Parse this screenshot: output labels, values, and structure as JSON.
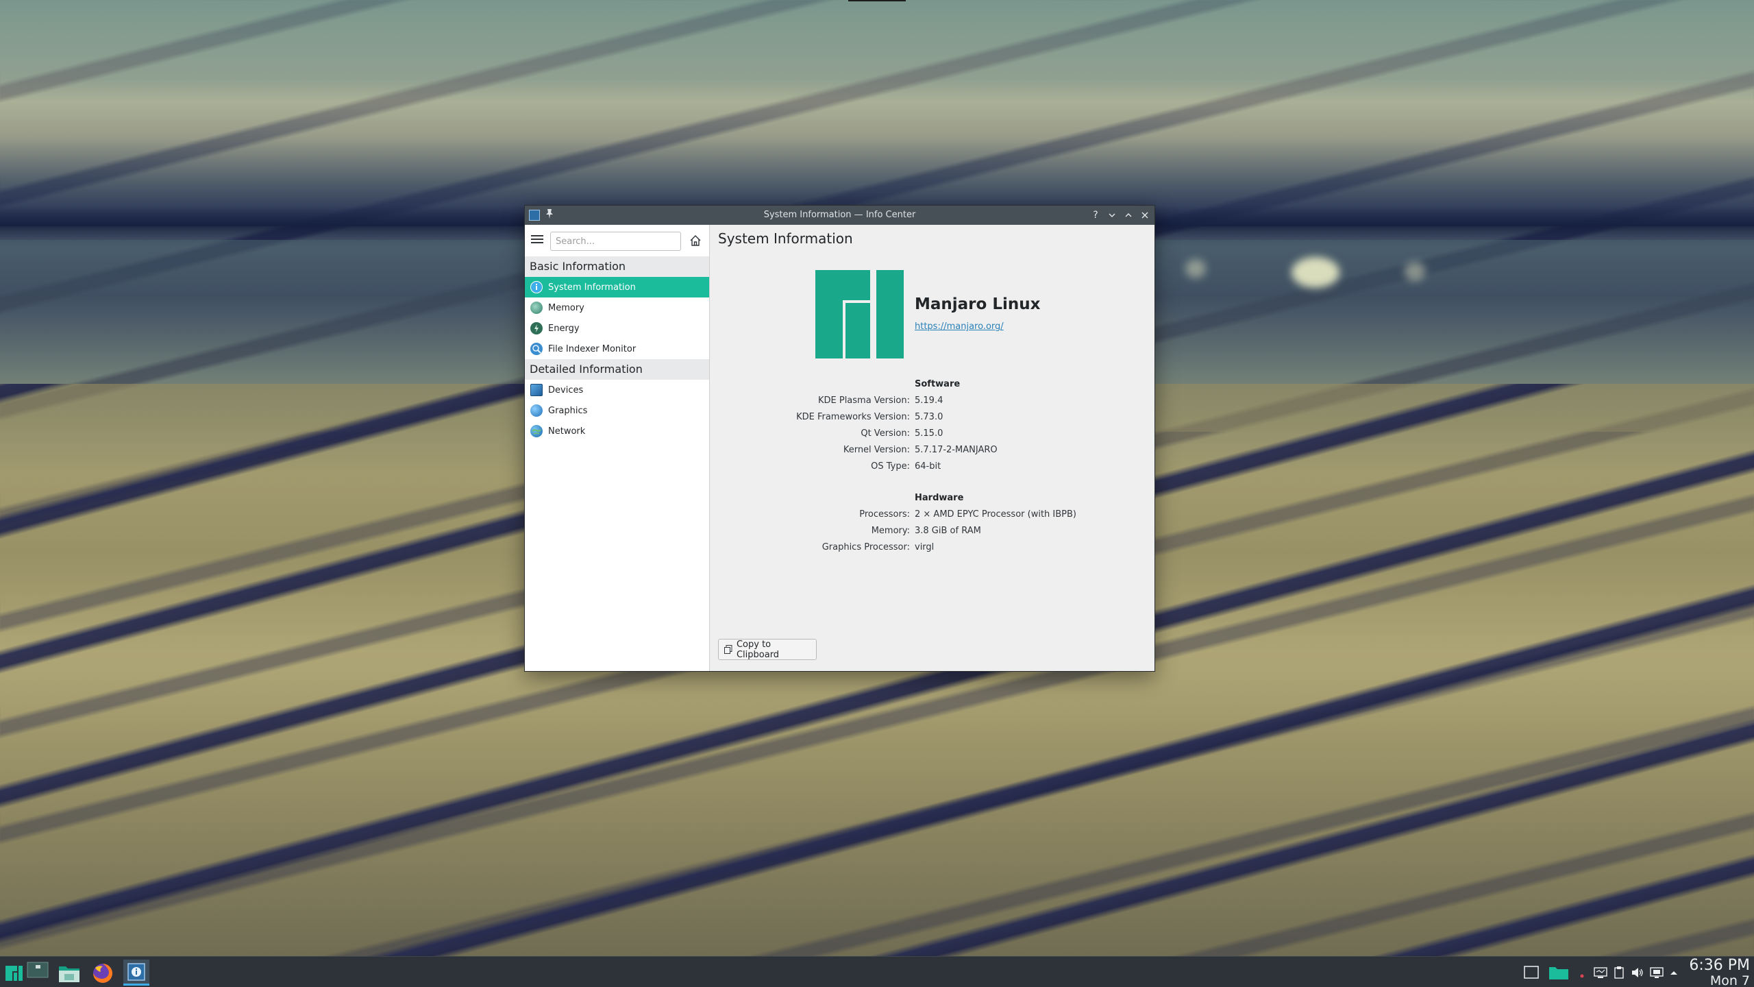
{
  "window": {
    "title": "System Information — Info Center",
    "buttons": {
      "help": "?",
      "minimize": "⌄",
      "maximize": "⌃",
      "close": "✕"
    }
  },
  "sidebar": {
    "search_placeholder": "Search...",
    "sections": [
      {
        "title": "Basic Information",
        "items": [
          {
            "label": "System Information",
            "icon": "info-icon",
            "selected": true
          },
          {
            "label": "Memory",
            "icon": "memory-icon"
          },
          {
            "label": "Energy",
            "icon": "energy-icon"
          },
          {
            "label": "File Indexer Monitor",
            "icon": "file-indexer-icon"
          }
        ]
      },
      {
        "title": "Detailed Information",
        "items": [
          {
            "label": "Devices",
            "icon": "devices-icon"
          },
          {
            "label": "Graphics",
            "icon": "graphics-icon"
          },
          {
            "label": "Network",
            "icon": "network-icon"
          }
        ]
      }
    ]
  },
  "main": {
    "title": "System Information",
    "distro_name": "Manjaro Linux",
    "distro_url": "https://manjaro.org/",
    "software": {
      "title": "Software",
      "rows": [
        {
          "label": "KDE Plasma Version:",
          "value": "5.19.4"
        },
        {
          "label": "KDE Frameworks Version:",
          "value": "5.73.0"
        },
        {
          "label": "Qt Version:",
          "value": "5.15.0"
        },
        {
          "label": "Kernel Version:",
          "value": "5.7.17-2-MANJARO"
        },
        {
          "label": "OS Type:",
          "value": "64-bit"
        }
      ]
    },
    "hardware": {
      "title": "Hardware",
      "rows": [
        {
          "label": "Processors:",
          "value": "2 × AMD EPYC Processor (with IBPB)"
        },
        {
          "label": "Memory:",
          "value": "3.8 GiB of RAM"
        },
        {
          "label": "Graphics Processor:",
          "value": "virgl"
        }
      ]
    },
    "copy_button": "Copy to Clipboard"
  },
  "taskbar": {
    "launchers": [
      "application-menu-icon",
      "desktop-pager-icon",
      "file-manager-icon",
      "firefox-icon",
      "info-center-icon"
    ],
    "tray": [
      "show-desktop-icon",
      "folder-icon",
      "record-indicator-icon",
      "display-icon",
      "clipboard-icon",
      "volume-icon",
      "network-icon",
      "expand-tray-icon"
    ],
    "clock_time": "6:36 PM",
    "clock_date": "Mon 7"
  },
  "colors": {
    "accent": "#1abc9c",
    "manjaro_green": "#1aa88a",
    "titlebar": "#475057",
    "taskbar": "#2d3338",
    "link": "#2980b9"
  }
}
